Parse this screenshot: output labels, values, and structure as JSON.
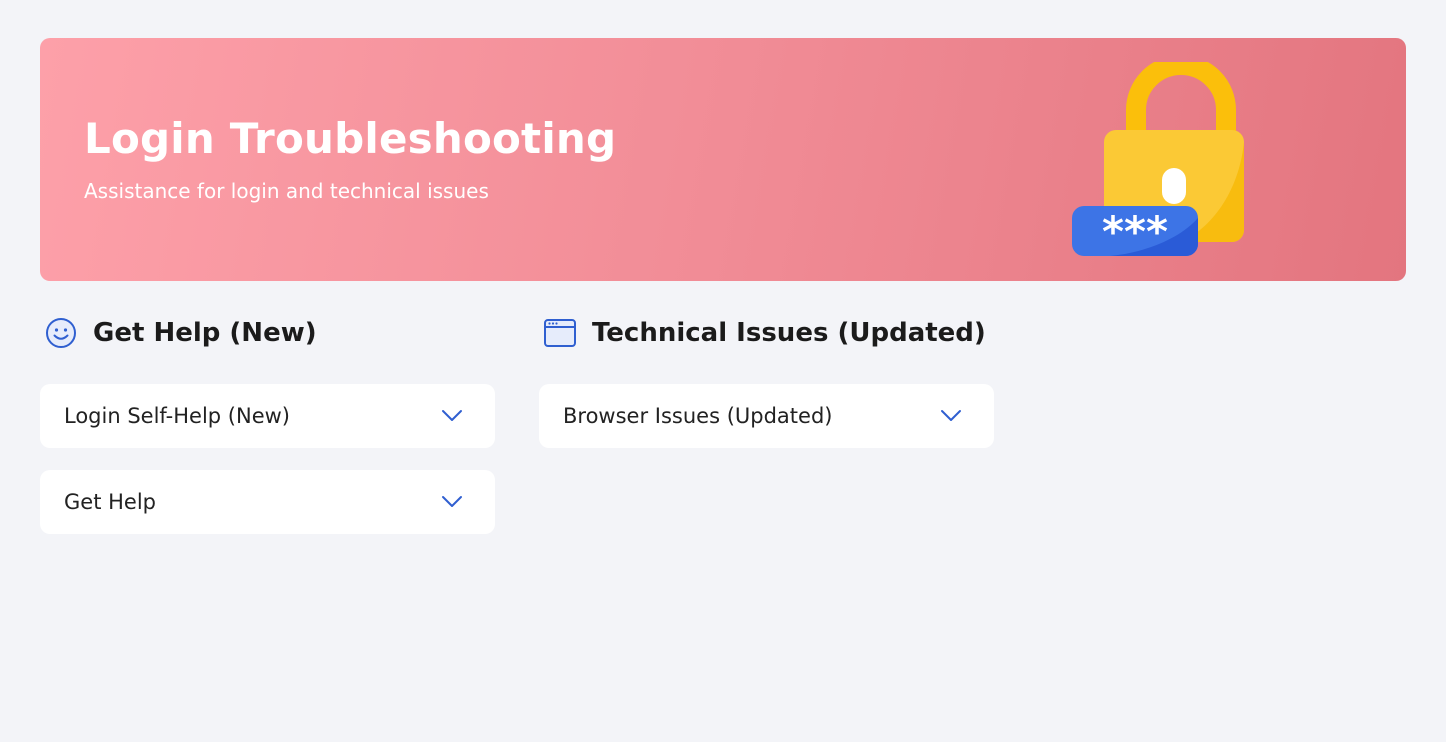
{
  "hero": {
    "title": "Login Troubleshooting",
    "subtitle": "Assistance for login and technical issues",
    "illustration_icon": "padlock-password-icon",
    "password_mask": "***"
  },
  "sections": [
    {
      "title": "Get Help (New)",
      "icon": "smiley-icon",
      "items": [
        {
          "label": "Login Self-Help (New)",
          "icon": "chevron-down-icon"
        },
        {
          "label": "Get Help",
          "icon": "chevron-down-icon"
        }
      ]
    },
    {
      "title": "Technical Issues (Updated)",
      "icon": "browser-window-icon",
      "items": [
        {
          "label": "Browser Issues (Updated)",
          "icon": "chevron-down-icon"
        }
      ]
    }
  ],
  "colors": {
    "page_background": "#f3f4f8",
    "hero_gradient_start": "#fda0a9",
    "hero_gradient_end": "#e3757f",
    "accent_blue": "#2f5fd0",
    "lock_yellow": "#fbc02d"
  }
}
